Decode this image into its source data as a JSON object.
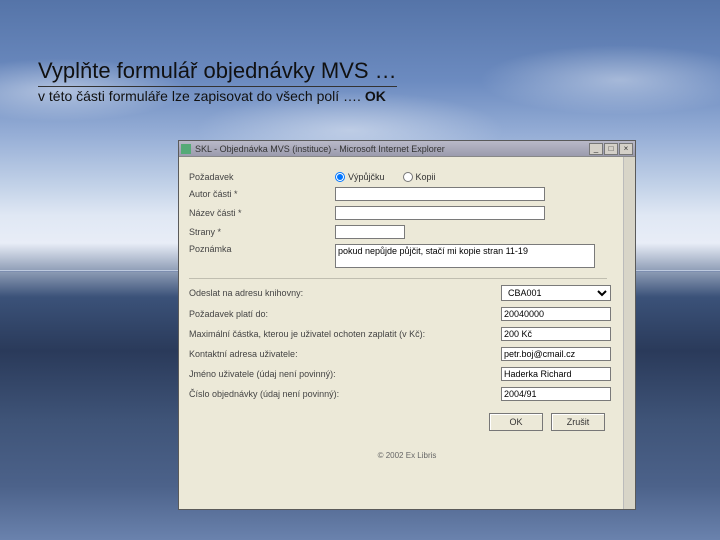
{
  "slide": {
    "title": "Vyplňte formulář objednávky MVS …",
    "text_plain": "v této části formuláře lze zapisovat do všech polí ….  ",
    "text_bold": "OK"
  },
  "window": {
    "title": "SKL - Objednávka MVS (instituce) - Microsoft Internet Explorer",
    "btn_min": "_",
    "btn_max": "□",
    "btn_close": "×"
  },
  "form": {
    "pozadavek_label": "Požadavek",
    "radio1": "Výpůjčku",
    "radio2": "Kopii",
    "autor_casti": "Autor části",
    "nazev_casti": "Název části",
    "strany": "Strany",
    "poznamka": "Poznámka",
    "poznamka_val": "pokud nepůjde půjčit, stačí mi kopie stran 11-19",
    "odeslat": "Odeslat na adresu knihovny:",
    "odeslat_val": "CBA001",
    "plati": "Požadavek platí do:",
    "plati_val": "20040000",
    "castka": "Maximální částka, kterou je uživatel ochoten zaplatit (v Kč):",
    "castka_val": "200 Kč",
    "kontakt": "Kontaktní adresa uživatele:",
    "kontakt_val": "petr.boj@cmail.cz",
    "jmeno": "Jméno uživatele (údaj není povinný):",
    "jmeno_val": "Haderka Richard",
    "cislo": "Číslo objednávky (údaj není povinný):",
    "cislo_val": "2004/91",
    "ok": "OK",
    "zrusit": "Zrušit"
  },
  "footer": "© 2002 Ex Libris"
}
